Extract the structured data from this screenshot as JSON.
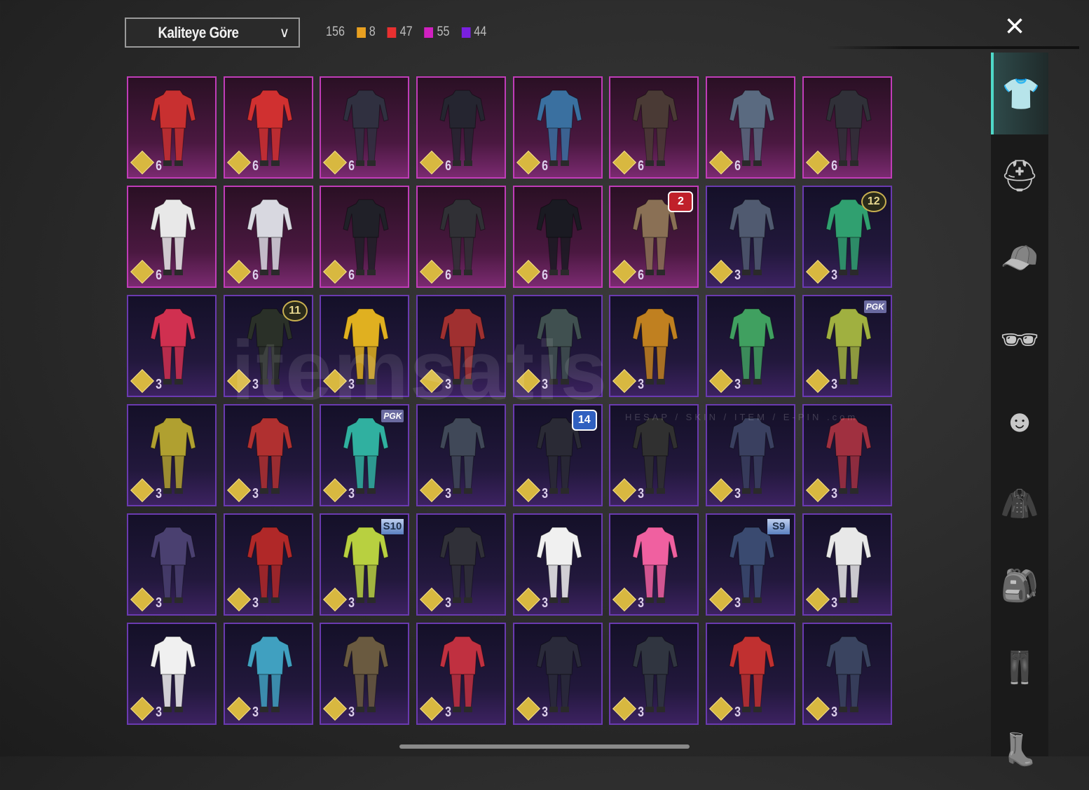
{
  "header": {
    "sort_label": "Kaliteye Göre",
    "total": "156",
    "counts": [
      {
        "color": "#e8a020",
        "value": "8"
      },
      {
        "color": "#e83030",
        "value": "47"
      },
      {
        "color": "#d020c0",
        "value": "55"
      },
      {
        "color": "#7a20e0",
        "value": "44"
      }
    ],
    "close_icon": "×"
  },
  "watermark": {
    "text": "itemsatis",
    "sub": "HESAP / SKIN / ITEM / E-PIN .com"
  },
  "sidebar": [
    {
      "name": "outfit",
      "glyph": "👕",
      "active": true
    },
    {
      "name": "helmet",
      "glyph": "⛑"
    },
    {
      "name": "cap",
      "glyph": "🧢"
    },
    {
      "name": "glasses",
      "glyph": "🕶"
    },
    {
      "name": "mask",
      "glyph": "☻"
    },
    {
      "name": "jacket",
      "glyph": "🧥"
    },
    {
      "name": "backpack",
      "glyph": "🎒"
    },
    {
      "name": "pants",
      "glyph": "👖"
    },
    {
      "name": "boots",
      "glyph": "👢"
    }
  ],
  "items": [
    {
      "v": "6",
      "q": "mag",
      "c": "#c83030"
    },
    {
      "v": "6",
      "q": "mag",
      "c": "#d03030"
    },
    {
      "v": "6",
      "q": "mag",
      "c": "#303040"
    },
    {
      "v": "6",
      "q": "mag",
      "c": "#252530"
    },
    {
      "v": "6",
      "q": "mag",
      "c": "#3a70a0"
    },
    {
      "v": "6",
      "q": "mag",
      "c": "#4a3a35"
    },
    {
      "v": "6",
      "q": "mag",
      "c": "#5a6a80"
    },
    {
      "v": "6",
      "q": "mag",
      "c": "#303038"
    },
    {
      "v": "6",
      "q": "mag",
      "c": "#e8e8e8"
    },
    {
      "v": "6",
      "q": "mag",
      "c": "#d8d8e0"
    },
    {
      "v": "6",
      "q": "mag",
      "c": "#202028"
    },
    {
      "v": "6",
      "q": "mag",
      "c": "#303035"
    },
    {
      "v": "6",
      "q": "mag",
      "c": "#1a1a22"
    },
    {
      "v": "6",
      "q": "mag",
      "c": "#8a7055",
      "badge": "2",
      "bt": "b-red"
    },
    {
      "v": "3",
      "q": "pur",
      "c": "#505a70"
    },
    {
      "v": "3",
      "q": "pur",
      "c": "#30a070",
      "badge": "12",
      "bt": "b-gold"
    },
    {
      "v": "3",
      "q": "pur",
      "c": "#d03050"
    },
    {
      "v": "3",
      "q": "pur",
      "c": "#2a3028",
      "badge": "11",
      "bt": "b-gold"
    },
    {
      "v": "3",
      "q": "pur",
      "c": "#e0b020"
    },
    {
      "v": "3",
      "q": "pur",
      "c": "#a03030"
    },
    {
      "v": "3",
      "q": "pur",
      "c": "#405050"
    },
    {
      "v": "3",
      "q": "pur",
      "c": "#c08020"
    },
    {
      "v": "3",
      "q": "pur",
      "c": "#40a060"
    },
    {
      "v": "3",
      "q": "pur",
      "c": "#a0b040",
      "badge": "PGK",
      "bt": "b-tag"
    },
    {
      "v": "3",
      "q": "pur",
      "c": "#b0a030"
    },
    {
      "v": "3",
      "q": "pur",
      "c": "#b03030"
    },
    {
      "v": "3",
      "q": "pur",
      "c": "#30b0a0",
      "badge": "PGK",
      "bt": "b-tag"
    },
    {
      "v": "3",
      "q": "pur",
      "c": "#404858"
    },
    {
      "v": "3",
      "q": "pur",
      "c": "#2a2a35",
      "badge": "14",
      "bt": "b-blue"
    },
    {
      "v": "3",
      "q": "pur",
      "c": "#303030"
    },
    {
      "v": "3",
      "q": "pur",
      "c": "#3a4060"
    },
    {
      "v": "3",
      "q": "pur",
      "c": "#a03040"
    },
    {
      "v": "3",
      "q": "pur",
      "c": "#4a4070"
    },
    {
      "v": "3",
      "q": "pur",
      "c": "#b02828"
    },
    {
      "v": "3",
      "q": "pur",
      "c": "#b8d040",
      "badge": "S10",
      "bt": "b-season"
    },
    {
      "v": "3",
      "q": "pur",
      "c": "#303038"
    },
    {
      "v": "3",
      "q": "pur",
      "c": "#f0f0f0"
    },
    {
      "v": "3",
      "q": "pur",
      "c": "#f060a0"
    },
    {
      "v": "3",
      "q": "pur",
      "c": "#3a4a70",
      "badge": "S9",
      "bt": "b-season"
    },
    {
      "v": "3",
      "q": "pur",
      "c": "#e8e8e8"
    },
    {
      "v": "3",
      "q": "pur",
      "c": "#f0f0f0"
    },
    {
      "v": "3",
      "q": "pur",
      "c": "#40a0c0"
    },
    {
      "v": "3",
      "q": "pur",
      "c": "#6a5a40"
    },
    {
      "v": "3",
      "q": "pur",
      "c": "#c03040"
    },
    {
      "v": "3",
      "q": "pur",
      "c": "#2a2a3a"
    },
    {
      "v": "3",
      "q": "pur",
      "c": "#303540"
    },
    {
      "v": "3",
      "q": "pur",
      "c": "#c03030"
    },
    {
      "v": "3",
      "q": "pur",
      "c": "#3a4460"
    }
  ]
}
